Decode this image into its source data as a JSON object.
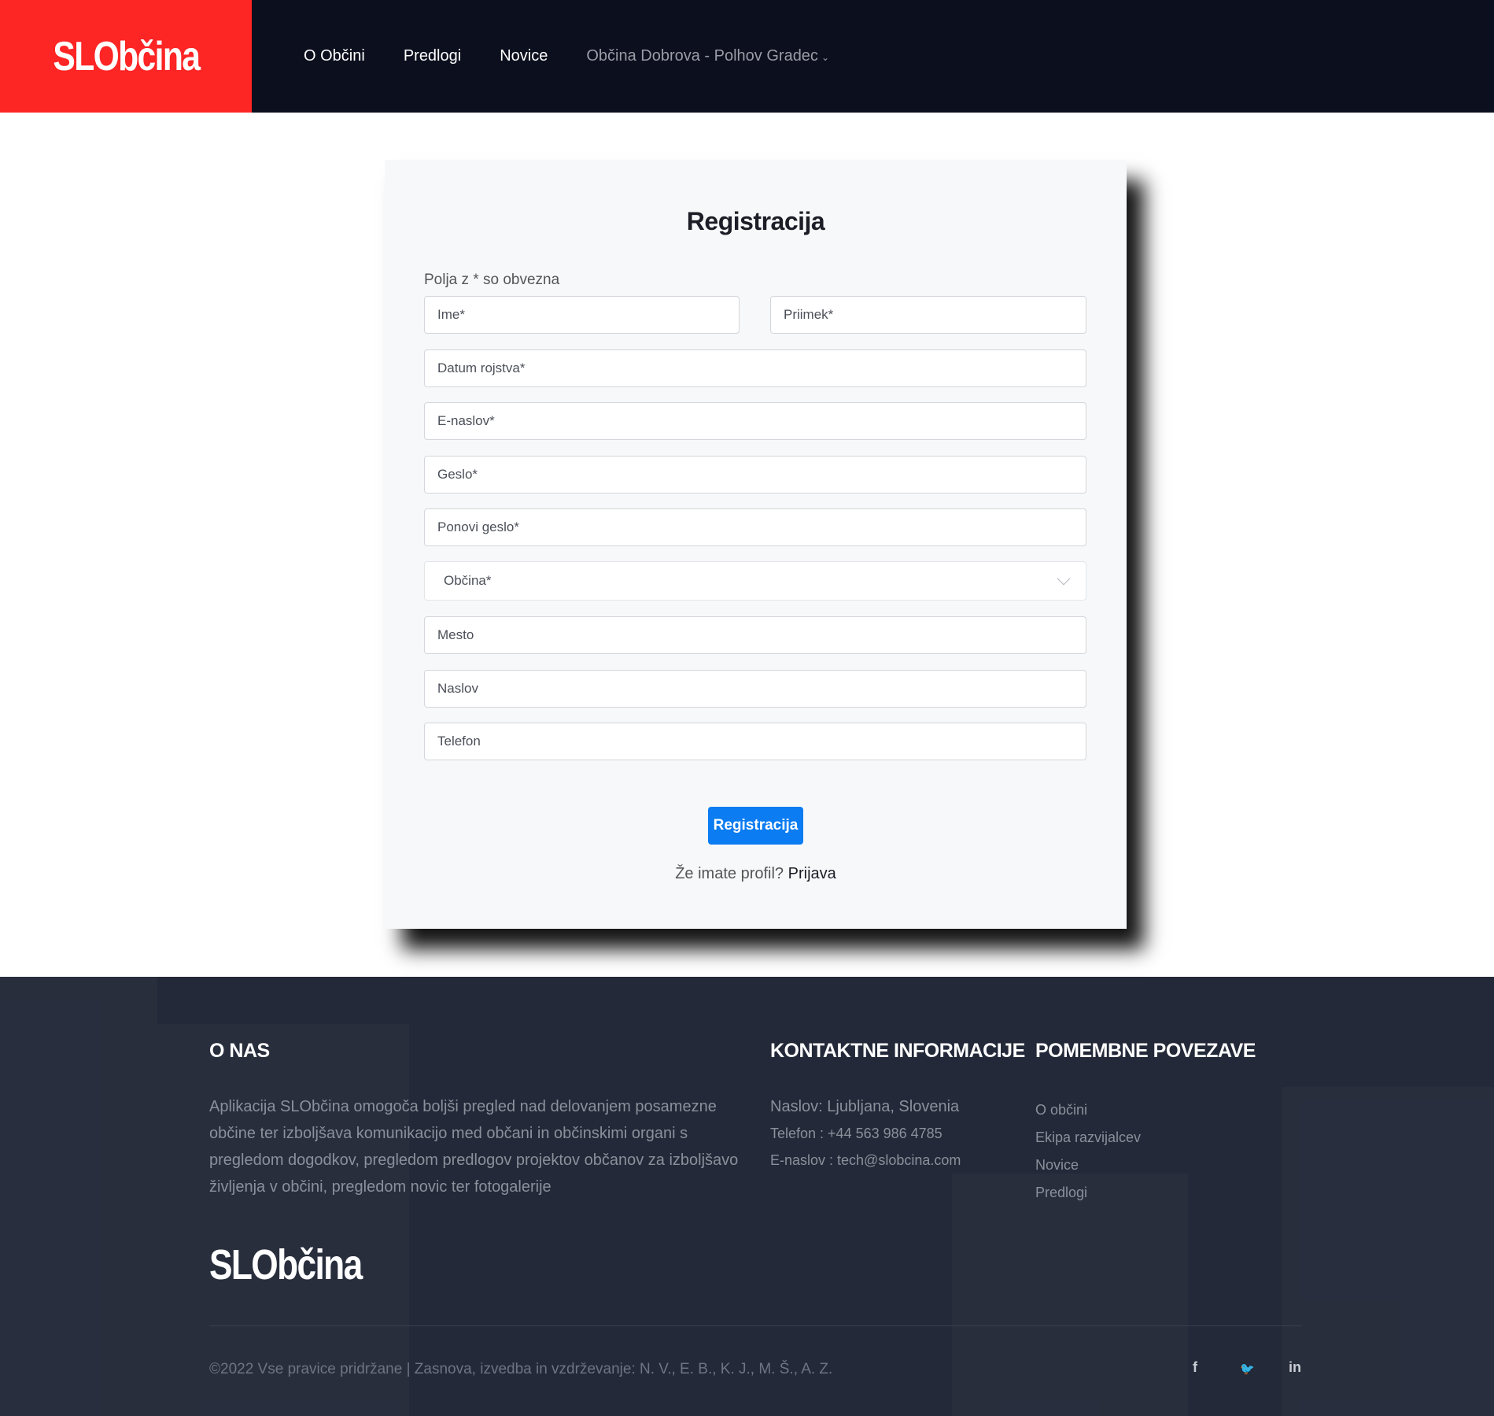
{
  "header": {
    "brand": "SLObčina",
    "nav": {
      "o_obcini": "O Občini",
      "predlogi": "Predlogi",
      "novice": "Novice",
      "municipality": "Občina Dobrova - Polhov Gradec",
      "municipality_chevron": "⌄"
    }
  },
  "form": {
    "title": "Registracija",
    "required_note": "Polja z * so obvezna",
    "placeholders": {
      "ime": "Ime*",
      "priimek": "Priimek*",
      "datum": "Datum rojstva*",
      "email": "E-naslov*",
      "geslo": "Geslo*",
      "ponovi_geslo": "Ponovi geslo*",
      "mesto": "Mesto",
      "naslov": "Naslov",
      "telefon": "Telefon"
    },
    "obcina_select": "Občina*",
    "submit_label": "Registracija",
    "login_prompt": "Že imate profil?",
    "login_link": "Prijava"
  },
  "footer": {
    "about_title": "O NAS",
    "about_text": "Aplikacija SLObčina omogoča boljši pregled nad delovanjem posamezne občine ter izboljšava komunikacijo med občani in občinskimi organi s pregledom dogodkov, pregledom predlogov projektov občanov za izboljšavo življenja v občini, pregledom novic ter fotogalerije",
    "contact_title": "KONTAKTNE INFORMACIJE",
    "contact": {
      "address": "Naslov: Ljubljana, Slovenia",
      "phone": "Telefon : +44 563 986 4785",
      "email": "E-naslov : tech@slobcina.com"
    },
    "links_title": "POMEMBNE POVEZAVE",
    "links": [
      "O občini",
      "Ekipa razvijalcev",
      "Novice",
      "Predlogi"
    ],
    "brand": "SLObčina",
    "copyright": "©2022 Vse pravice pridržane | Zasnova, izvedba in vzdrževanje: N. V., E. B., K. J., M. Š., A. Z.",
    "social": {
      "facebook": "f",
      "twitter": "🐦",
      "linkedin": "in"
    }
  }
}
